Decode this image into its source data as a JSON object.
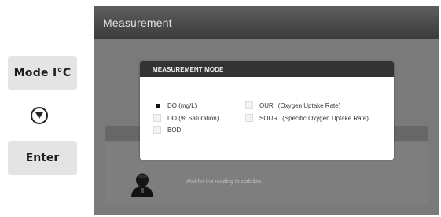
{
  "keys": {
    "mode_label": "Mode I°C",
    "enter_label": "Enter"
  },
  "screen": {
    "title": "Measurement",
    "hint": "Wait for the reading to stabilize."
  },
  "modal": {
    "title": "MEASUREMENT MODE",
    "selected": "DO (mg/L)",
    "options": [
      {
        "label": "DO (mg/L)"
      },
      {
        "label": "DO (% Saturation)"
      },
      {
        "label": "BOD"
      },
      {
        "label": "OUR",
        "detail": "(Oxygen Uptake Rate)"
      },
      {
        "label": "SOUR",
        "detail": "(Specific Oxygen Uptake Rate)"
      }
    ]
  },
  "colors": {
    "screen_bg": "#7a7a7a",
    "title_bar": "#3c3c3c",
    "modal_header": "#333333",
    "key_bg": "#e4e4e4"
  },
  "icons": {
    "down": "down-arrow-circle-icon",
    "operator": "operator-person-icon"
  }
}
